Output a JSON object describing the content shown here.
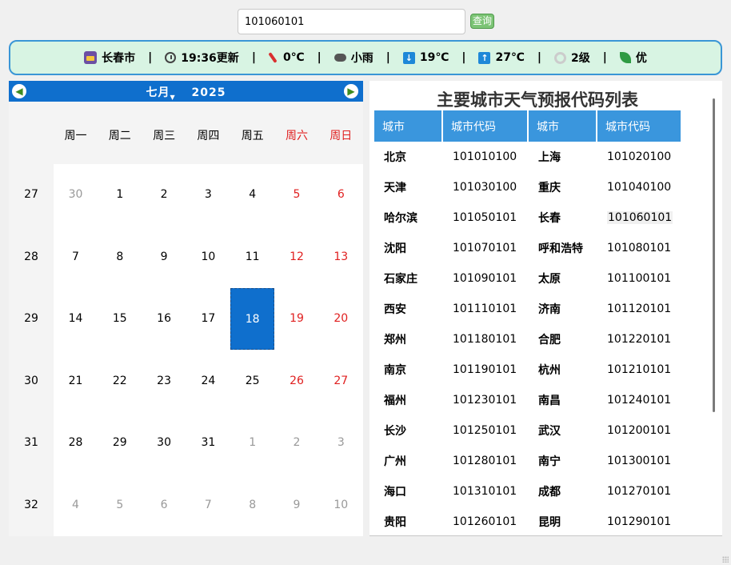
{
  "search": {
    "value": "101060101",
    "button_label": "查询"
  },
  "weather": {
    "city": "长春市",
    "update": "19:36更新",
    "temp_now": "0℃",
    "condition": "小雨",
    "low": "19℃",
    "high": "27℃",
    "wind": "2级",
    "air": "优",
    "separator": "|"
  },
  "calendar": {
    "month_label": "七月",
    "year_label": "2025",
    "prev_icon": "◀",
    "next_icon": "▶",
    "weekdays": [
      "周一",
      "周二",
      "周三",
      "周四",
      "周五",
      "周六",
      "周日"
    ],
    "weeks": [
      {
        "num": "27",
        "days": [
          {
            "d": "30",
            "o": true
          },
          {
            "d": "1"
          },
          {
            "d": "2"
          },
          {
            "d": "3"
          },
          {
            "d": "4"
          },
          {
            "d": "5"
          },
          {
            "d": "6"
          }
        ]
      },
      {
        "num": "28",
        "days": [
          {
            "d": "7"
          },
          {
            "d": "8"
          },
          {
            "d": "9"
          },
          {
            "d": "10"
          },
          {
            "d": "11"
          },
          {
            "d": "12"
          },
          {
            "d": "13"
          }
        ]
      },
      {
        "num": "29",
        "days": [
          {
            "d": "14"
          },
          {
            "d": "15"
          },
          {
            "d": "16"
          },
          {
            "d": "17"
          },
          {
            "d": "18",
            "t": true
          },
          {
            "d": "19"
          },
          {
            "d": "20"
          }
        ]
      },
      {
        "num": "30",
        "days": [
          {
            "d": "21"
          },
          {
            "d": "22"
          },
          {
            "d": "23"
          },
          {
            "d": "24"
          },
          {
            "d": "25"
          },
          {
            "d": "26"
          },
          {
            "d": "27"
          }
        ]
      },
      {
        "num": "31",
        "days": [
          {
            "d": "28"
          },
          {
            "d": "29"
          },
          {
            "d": "30"
          },
          {
            "d": "31"
          },
          {
            "d": "1",
            "o": true
          },
          {
            "d": "2",
            "o": true
          },
          {
            "d": "3",
            "o": true
          }
        ]
      },
      {
        "num": "32",
        "days": [
          {
            "d": "4",
            "o": true
          },
          {
            "d": "5",
            "o": true
          },
          {
            "d": "6",
            "o": true
          },
          {
            "d": "7",
            "o": true
          },
          {
            "d": "8",
            "o": true
          },
          {
            "d": "9",
            "o": true
          },
          {
            "d": "10",
            "o": true
          }
        ]
      }
    ],
    "colors": {
      "header": "#0f6fcd",
      "weekend": "#e02020"
    }
  },
  "city_table": {
    "title": "主要城市天气预报代码列表",
    "headers": [
      "城市",
      "城市代码",
      "城市",
      "城市代码"
    ],
    "rows": [
      [
        "北京",
        "101010100",
        "上海",
        "101020100"
      ],
      [
        "天津",
        "101030100",
        "重庆",
        "101040100"
      ],
      [
        "哈尔滨",
        "101050101",
        "长春",
        "101060101"
      ],
      [
        "沈阳",
        "101070101",
        "呼和浩特",
        "101080101"
      ],
      [
        "石家庄",
        "101090101",
        "太原",
        "101100101"
      ],
      [
        "西安",
        "101110101",
        "济南",
        "101120101"
      ],
      [
        "郑州",
        "101180101",
        "合肥",
        "101220101"
      ],
      [
        "南京",
        "101190101",
        "杭州",
        "101210101"
      ],
      [
        "福州",
        "101230101",
        "南昌",
        "101240101"
      ],
      [
        "长沙",
        "101250101",
        "武汉",
        "101200101"
      ],
      [
        "广州",
        "101280101",
        "南宁",
        "101300101"
      ],
      [
        "海口",
        "101310101",
        "成都",
        "101270101"
      ],
      [
        "贵阳",
        "101260101",
        "昆明",
        "101290101"
      ]
    ]
  }
}
